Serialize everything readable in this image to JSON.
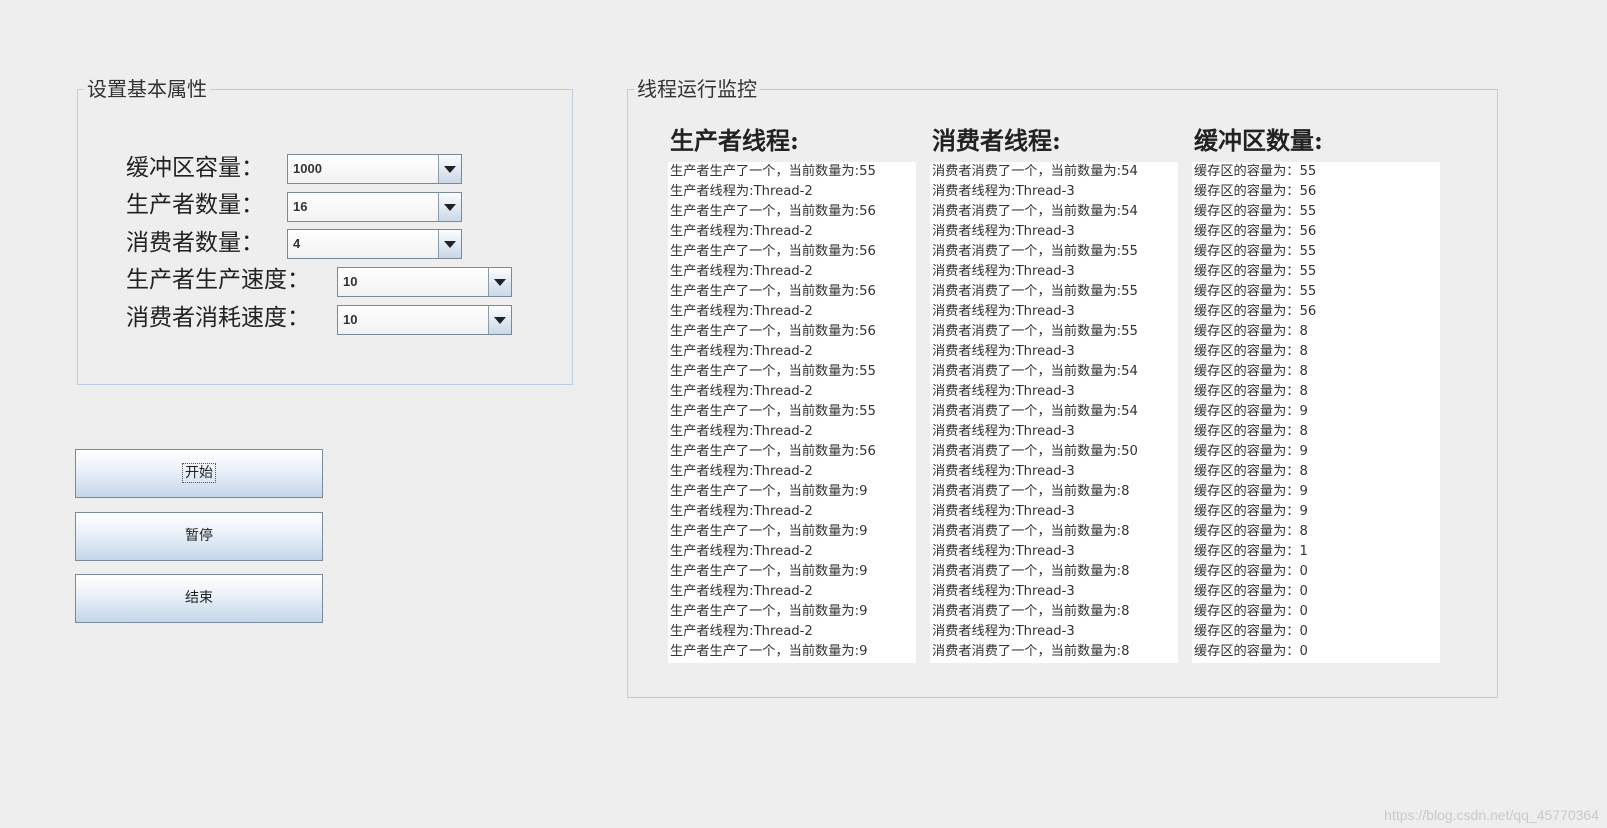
{
  "settings": {
    "title": "设置基本属性",
    "fields": [
      {
        "label": "缓冲区容量：",
        "value": "1000"
      },
      {
        "label": "生产者数量：",
        "value": "16"
      },
      {
        "label": "消费者数量：",
        "value": "4"
      },
      {
        "label": "生产者生产速度：",
        "value": "10"
      },
      {
        "label": "消费者消耗速度：",
        "value": "10"
      }
    ]
  },
  "buttons": {
    "start_label": "开始",
    "pause_label": "暂停",
    "stop_label": "结束"
  },
  "monitor": {
    "title": "线程运行监控",
    "producer_title": "生产者线程:",
    "consumer_title": "消费者线程:",
    "buffer_title": "缓冲区数量:",
    "producer_log": [
      "生产者生产了一个，当前数量为:55",
      "生产者线程为:Thread-2",
      "生产者生产了一个，当前数量为:56",
      "生产者线程为:Thread-2",
      "生产者生产了一个，当前数量为:56",
      "生产者线程为:Thread-2",
      "生产者生产了一个，当前数量为:56",
      "生产者线程为:Thread-2",
      "生产者生产了一个，当前数量为:56",
      "生产者线程为:Thread-2",
      "生产者生产了一个，当前数量为:55",
      "生产者线程为:Thread-2",
      "生产者生产了一个，当前数量为:55",
      "生产者线程为:Thread-2",
      "生产者生产了一个，当前数量为:56",
      "生产者线程为:Thread-2",
      "生产者生产了一个，当前数量为:9",
      "生产者线程为:Thread-2",
      "生产者生产了一个，当前数量为:9",
      "生产者线程为:Thread-2",
      "生产者生产了一个，当前数量为:9",
      "生产者线程为:Thread-2",
      "生产者生产了一个，当前数量为:9",
      "生产者线程为:Thread-2",
      "生产者生产了一个，当前数量为:9"
    ],
    "consumer_log": [
      "消费者消费了一个，当前数量为:54",
      "消费者线程为:Thread-3",
      "消费者消费了一个，当前数量为:54",
      "消费者线程为:Thread-3",
      "消费者消费了一个，当前数量为:55",
      "消费者线程为:Thread-3",
      "消费者消费了一个，当前数量为:55",
      "消费者线程为:Thread-3",
      "消费者消费了一个，当前数量为:55",
      "消费者线程为:Thread-3",
      "消费者消费了一个，当前数量为:54",
      "消费者线程为:Thread-3",
      "消费者消费了一个，当前数量为:54",
      "消费者线程为:Thread-3",
      "消费者消费了一个，当前数量为:50",
      "消费者线程为:Thread-3",
      "消费者消费了一个，当前数量为:8",
      "消费者线程为:Thread-3",
      "消费者消费了一个，当前数量为:8",
      "消费者线程为:Thread-3",
      "消费者消费了一个，当前数量为:8",
      "消费者线程为:Thread-3",
      "消费者消费了一个，当前数量为:8",
      "消费者线程为:Thread-3",
      "消费者消费了一个，当前数量为:8"
    ],
    "buffer_log": [
      "缓存区的容量为：55",
      "缓存区的容量为：56",
      "缓存区的容量为：55",
      "缓存区的容量为：56",
      "缓存区的容量为：55",
      "缓存区的容量为：55",
      "缓存区的容量为：55",
      "缓存区的容量为：56",
      "缓存区的容量为：8",
      "缓存区的容量为：8",
      "缓存区的容量为：8",
      "缓存区的容量为：8",
      "缓存区的容量为：9",
      "缓存区的容量为：8",
      "缓存区的容量为：9",
      "缓存区的容量为：8",
      "缓存区的容量为：9",
      "缓存区的容量为：9",
      "缓存区的容量为：8",
      "缓存区的容量为：1",
      "缓存区的容量为：0",
      "缓存区的容量为：0",
      "缓存区的容量为：0",
      "缓存区的容量为：0",
      "缓存区的容量为：0"
    ]
  },
  "watermark": "https://blog.csdn.net/qq_45770364"
}
